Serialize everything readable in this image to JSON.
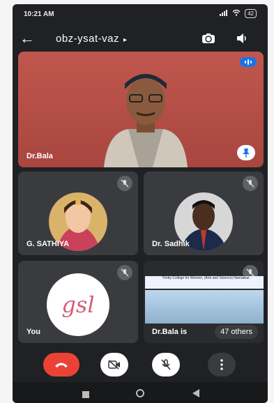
{
  "status": {
    "time": "10:21 AM",
    "battery": "42"
  },
  "header": {
    "meeting_code": "obz-ysat-vaz",
    "arrow": "▸"
  },
  "main_tile": {
    "name": "Dr.Bala"
  },
  "tiles": [
    {
      "name": "G. SATHIYA"
    },
    {
      "name": "Dr. Sadhik"
    },
    {
      "name": "You",
      "logo_text": "gsl"
    },
    {
      "name": "Dr.Bala is",
      "others_label": "47 others",
      "banner": "Trinity College for Women, (Arts and Science) Namakkal"
    }
  ],
  "colors": {
    "end_call": "#ea4335",
    "accent": "#1a73e8"
  }
}
